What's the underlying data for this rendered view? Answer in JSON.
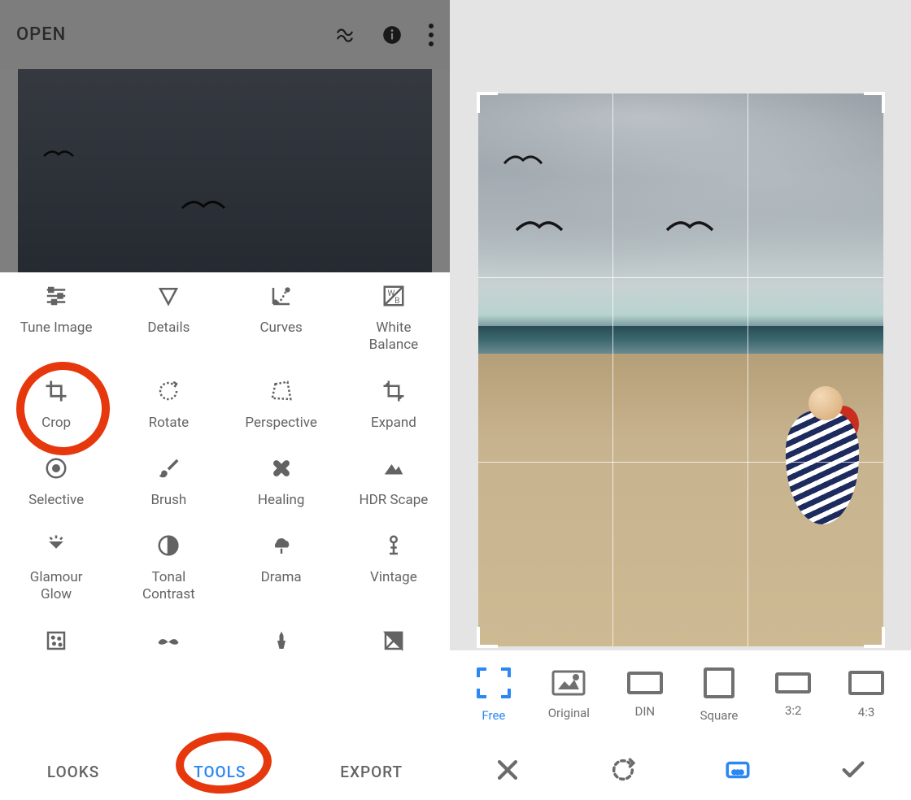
{
  "left": {
    "open_label": "OPEN",
    "tools": [
      [
        {
          "id": "tune-image",
          "label": "Tune Image"
        },
        {
          "id": "details",
          "label": "Details"
        },
        {
          "id": "curves",
          "label": "Curves"
        },
        {
          "id": "white-balance",
          "label": "White\nBalance"
        }
      ],
      [
        {
          "id": "crop",
          "label": "Crop"
        },
        {
          "id": "rotate",
          "label": "Rotate"
        },
        {
          "id": "perspective",
          "label": "Perspective"
        },
        {
          "id": "expand",
          "label": "Expand"
        }
      ],
      [
        {
          "id": "selective",
          "label": "Selective"
        },
        {
          "id": "brush",
          "label": "Brush"
        },
        {
          "id": "healing",
          "label": "Healing"
        },
        {
          "id": "hdr-scape",
          "label": "HDR Scape"
        }
      ],
      [
        {
          "id": "glamour-glow",
          "label": "Glamour\nGlow"
        },
        {
          "id": "tonal-contrast",
          "label": "Tonal\nContrast"
        },
        {
          "id": "drama",
          "label": "Drama"
        },
        {
          "id": "vintage",
          "label": "Vintage"
        }
      ],
      [
        {
          "id": "grainy-film",
          "label": ""
        },
        {
          "id": "retrolux",
          "label": ""
        },
        {
          "id": "grunge",
          "label": ""
        },
        {
          "id": "black-white",
          "label": ""
        }
      ]
    ],
    "tabs": {
      "looks": "LOOKS",
      "tools": "TOOLS",
      "export": "EXPORT",
      "active": "tools"
    }
  },
  "right": {
    "aspects": [
      {
        "id": "free",
        "label": "Free",
        "active": true
      },
      {
        "id": "original",
        "label": "Original"
      },
      {
        "id": "din",
        "label": "DIN"
      },
      {
        "id": "square",
        "label": "Square"
      },
      {
        "id": "3-2",
        "label": "3:2"
      },
      {
        "id": "4-3",
        "label": "4:3"
      }
    ],
    "actions": {
      "cancel": "cancel",
      "rotate": "rotate",
      "aspect": "aspect",
      "confirm": "confirm"
    }
  },
  "annotations": {
    "highlighted_tool": "Crop",
    "highlighted_tab": "TOOLS"
  }
}
